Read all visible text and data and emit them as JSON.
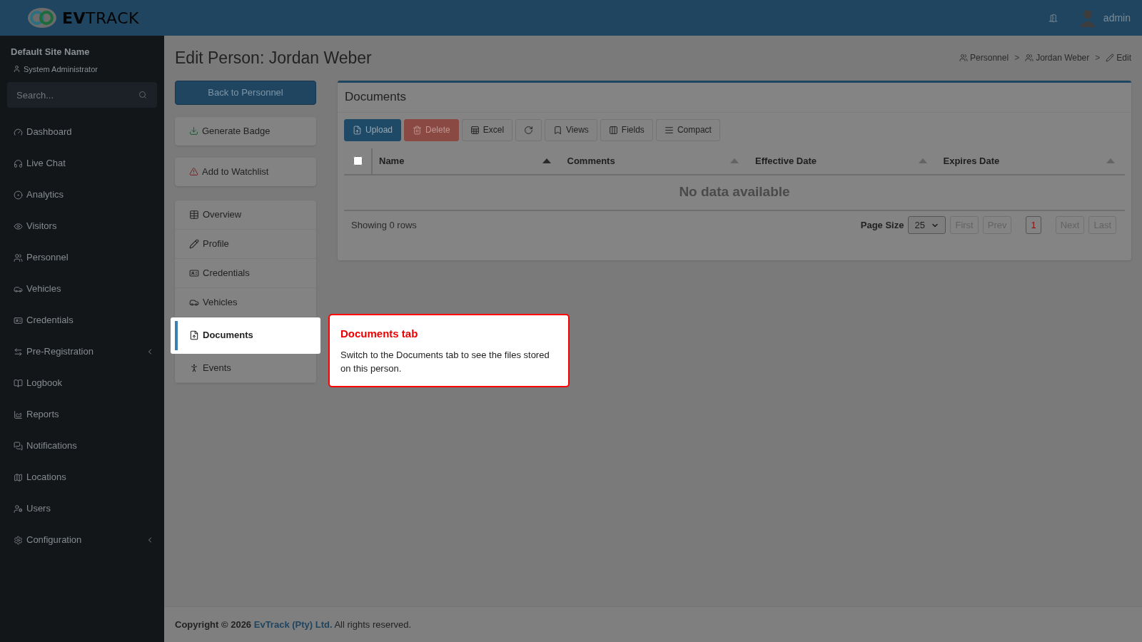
{
  "topbar": {
    "logo": "**EV**TRACK",
    "user": "admin"
  },
  "sidebar": {
    "site_name": "Default Site Name",
    "role": "System Administrator",
    "search_placeholder": "Search...",
    "items": [
      {
        "label": "Dashboard",
        "expandable": false
      },
      {
        "label": "Live Chat",
        "expandable": false
      },
      {
        "label": "Analytics",
        "expandable": false
      },
      {
        "label": "Visitors",
        "expandable": false
      },
      {
        "label": "Personnel",
        "expandable": false
      },
      {
        "label": "Vehicles",
        "expandable": false
      },
      {
        "label": "Credentials",
        "expandable": false
      },
      {
        "label": "Pre-Registration",
        "expandable": true
      },
      {
        "label": "Logbook",
        "expandable": false
      },
      {
        "label": "Reports",
        "expandable": false
      },
      {
        "label": "Notifications",
        "expandable": false
      },
      {
        "label": "Locations",
        "expandable": false
      },
      {
        "label": "Users",
        "expandable": false
      },
      {
        "label": "Configuration",
        "expandable": true
      }
    ]
  },
  "page": {
    "title": "Edit Person: Jordan Weber",
    "breadcrumbs": [
      "Personnel",
      "Jordan Weber",
      "Edit"
    ],
    "breadcrumb_separator": ">",
    "back_button": "Back to Personnel",
    "actions": [
      "Generate Badge",
      "Add to Watchlist"
    ],
    "tabs": [
      {
        "label": "Overview",
        "selected": false
      },
      {
        "label": "Profile",
        "selected": false
      },
      {
        "label": "Credentials",
        "selected": false
      },
      {
        "label": "Vehicles",
        "selected": false
      },
      {
        "label": "Documents",
        "selected": true
      },
      {
        "label": "Events",
        "selected": false
      }
    ]
  },
  "documents": {
    "title": "Documents",
    "toolbar": [
      {
        "kind": "upload",
        "label": "Upload"
      },
      {
        "kind": "delete",
        "label": "Delete"
      },
      {
        "kind": "excel",
        "label": "Excel"
      },
      {
        "kind": "refresh"
      },
      {
        "kind": "views",
        "label": "Views"
      },
      {
        "kind": "fields",
        "label": "Fields"
      },
      {
        "kind": "compact",
        "label": "Compact"
      }
    ],
    "select_all_checked": false,
    "columns": [
      "Name",
      "Comments",
      "Effective Date",
      "Expires Date"
    ],
    "empty_message": "No data available",
    "showing": "Showing 0 rows",
    "page_size_label": "Page Size",
    "page_size": "25",
    "pager": [
      {
        "label": "First",
        "selected": false
      },
      {
        "label": "Prev",
        "selected": false
      },
      {
        "label": "1",
        "selected": true
      },
      {
        "label": "Next",
        "selected": false
      },
      {
        "label": "Last",
        "selected": false
      }
    ]
  },
  "tooltip": {
    "title": "Documents tab",
    "text": "Switch to the Documents tab to see the files stored on this person."
  },
  "footer": {
    "prefix": "Copyright © 2026",
    "link": "EvTrack (Pty) Ltd.",
    "suffix": "All rights reserved."
  }
}
